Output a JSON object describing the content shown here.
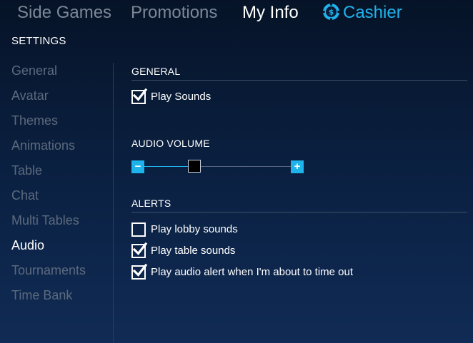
{
  "nav": {
    "items": [
      "Side Games",
      "Promotions",
      "My Info"
    ],
    "cashier": "Cashier"
  },
  "settings_title": "SETTINGS",
  "sidebar": {
    "items": [
      {
        "label": "General",
        "active": false
      },
      {
        "label": "Avatar",
        "active": false
      },
      {
        "label": "Themes",
        "active": false
      },
      {
        "label": "Animations",
        "active": false
      },
      {
        "label": "Table",
        "active": false
      },
      {
        "label": "Chat",
        "active": false
      },
      {
        "label": "Multi Tables",
        "active": false
      },
      {
        "label": "Audio",
        "active": true
      },
      {
        "label": "Tournaments",
        "active": false
      },
      {
        "label": "Time Bank",
        "active": false
      }
    ]
  },
  "general": {
    "title": "GENERAL",
    "play_sounds": {
      "label": "Play Sounds",
      "checked": true
    }
  },
  "audio_volume": {
    "title": "AUDIO VOLUME",
    "minus": "−",
    "plus": "+",
    "level_fraction": 0.34
  },
  "alerts": {
    "title": "ALERTS",
    "options": [
      {
        "label": "Play lobby sounds",
        "checked": false
      },
      {
        "label": "Play table sounds",
        "checked": true
      },
      {
        "label": "Play audio alert when I'm about to time out",
        "checked": true
      }
    ]
  },
  "colors": {
    "accent": "#1fb3ec",
    "nav_dim": "#7c8797",
    "sidebar_dim": "#5c6a7d",
    "background_top": "#061327",
    "background_bottom": "#102b55"
  }
}
